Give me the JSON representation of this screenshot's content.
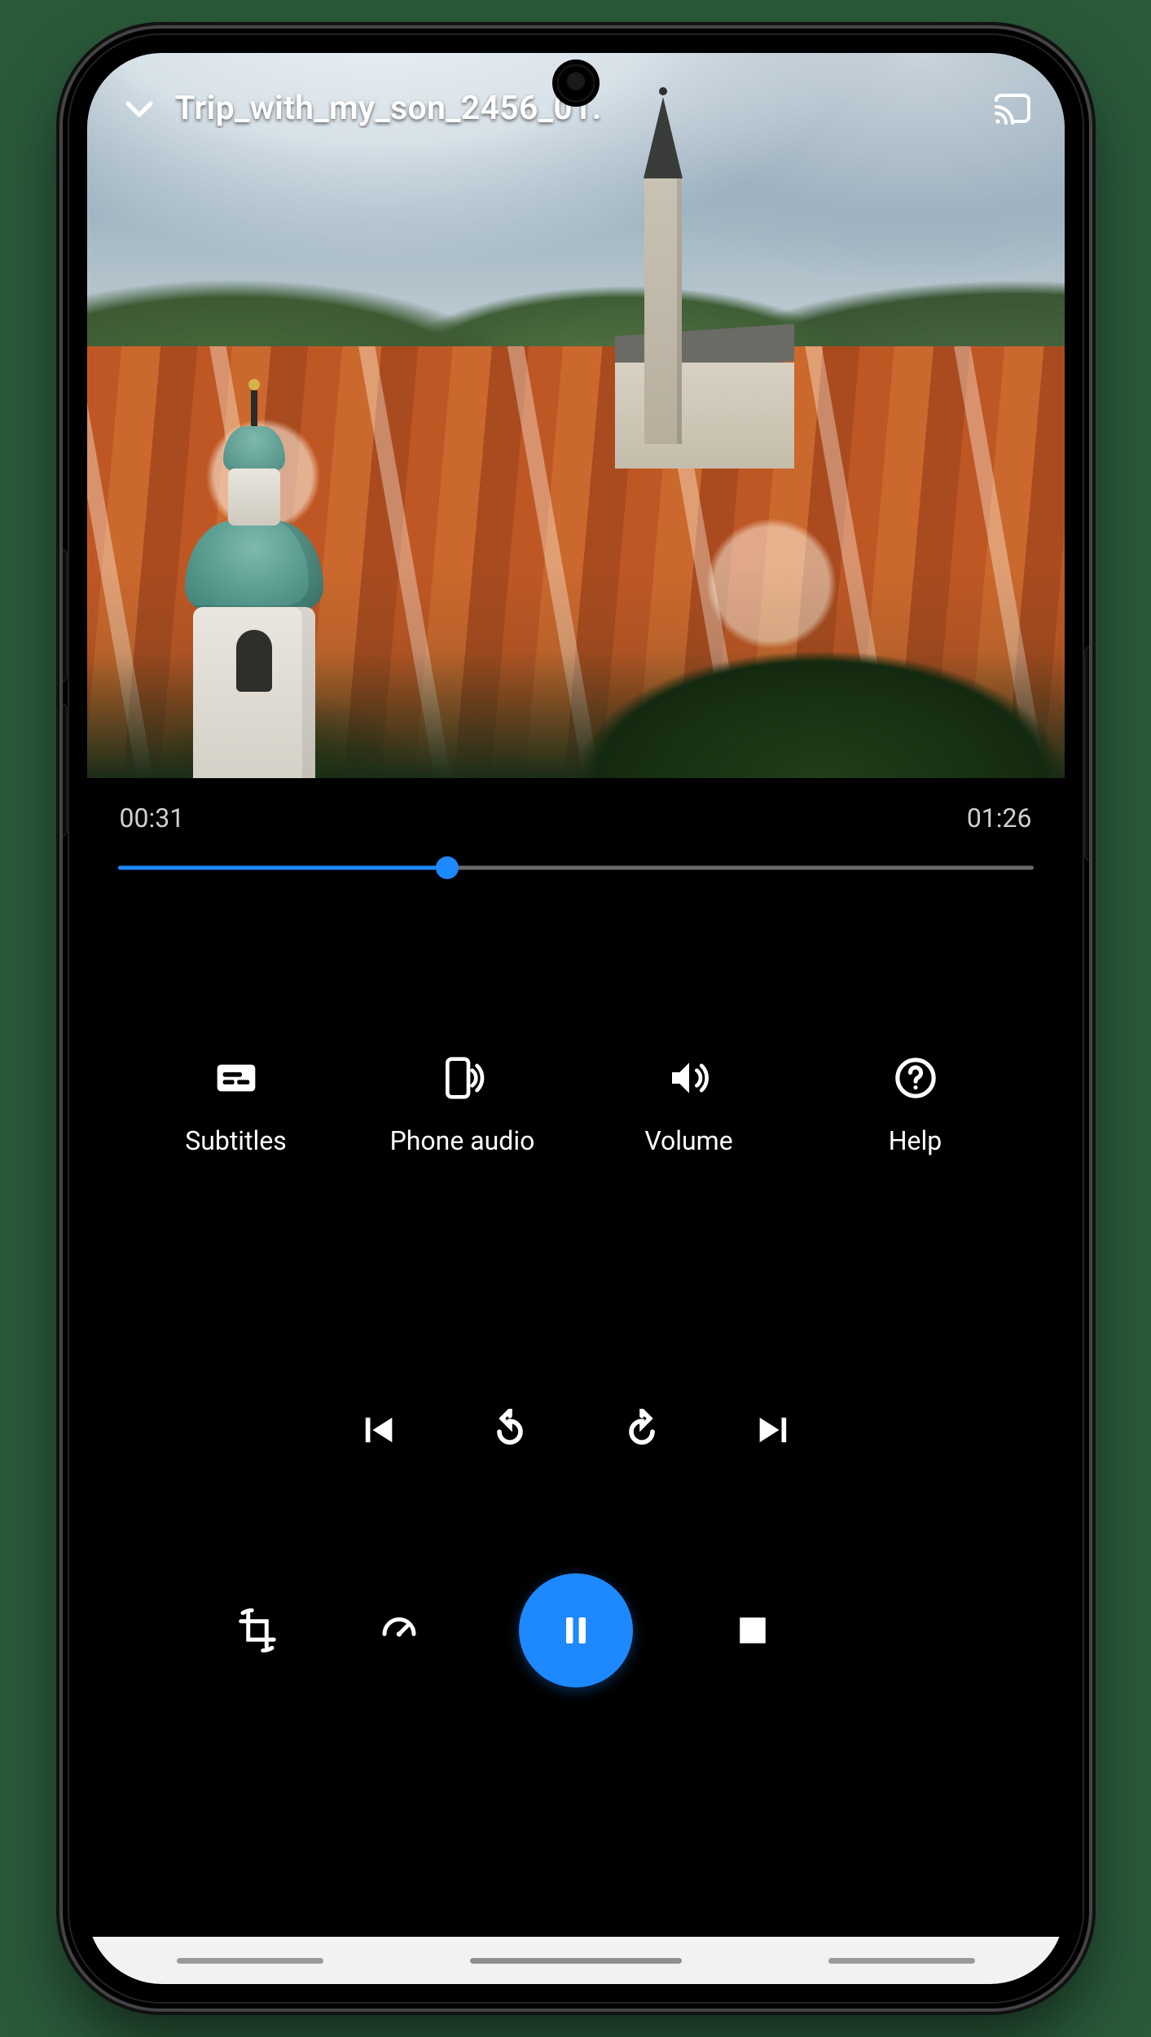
{
  "colors": {
    "accent": "#1e88ff"
  },
  "header": {
    "title": "Trip_with_my_son_2456_01."
  },
  "playback": {
    "current_time": "00:31",
    "duration": "01:26",
    "progress_percent": 36
  },
  "options": {
    "subtitles": "Subtitles",
    "phone_audio": "Phone audio",
    "volume": "Volume",
    "help": "Help"
  }
}
